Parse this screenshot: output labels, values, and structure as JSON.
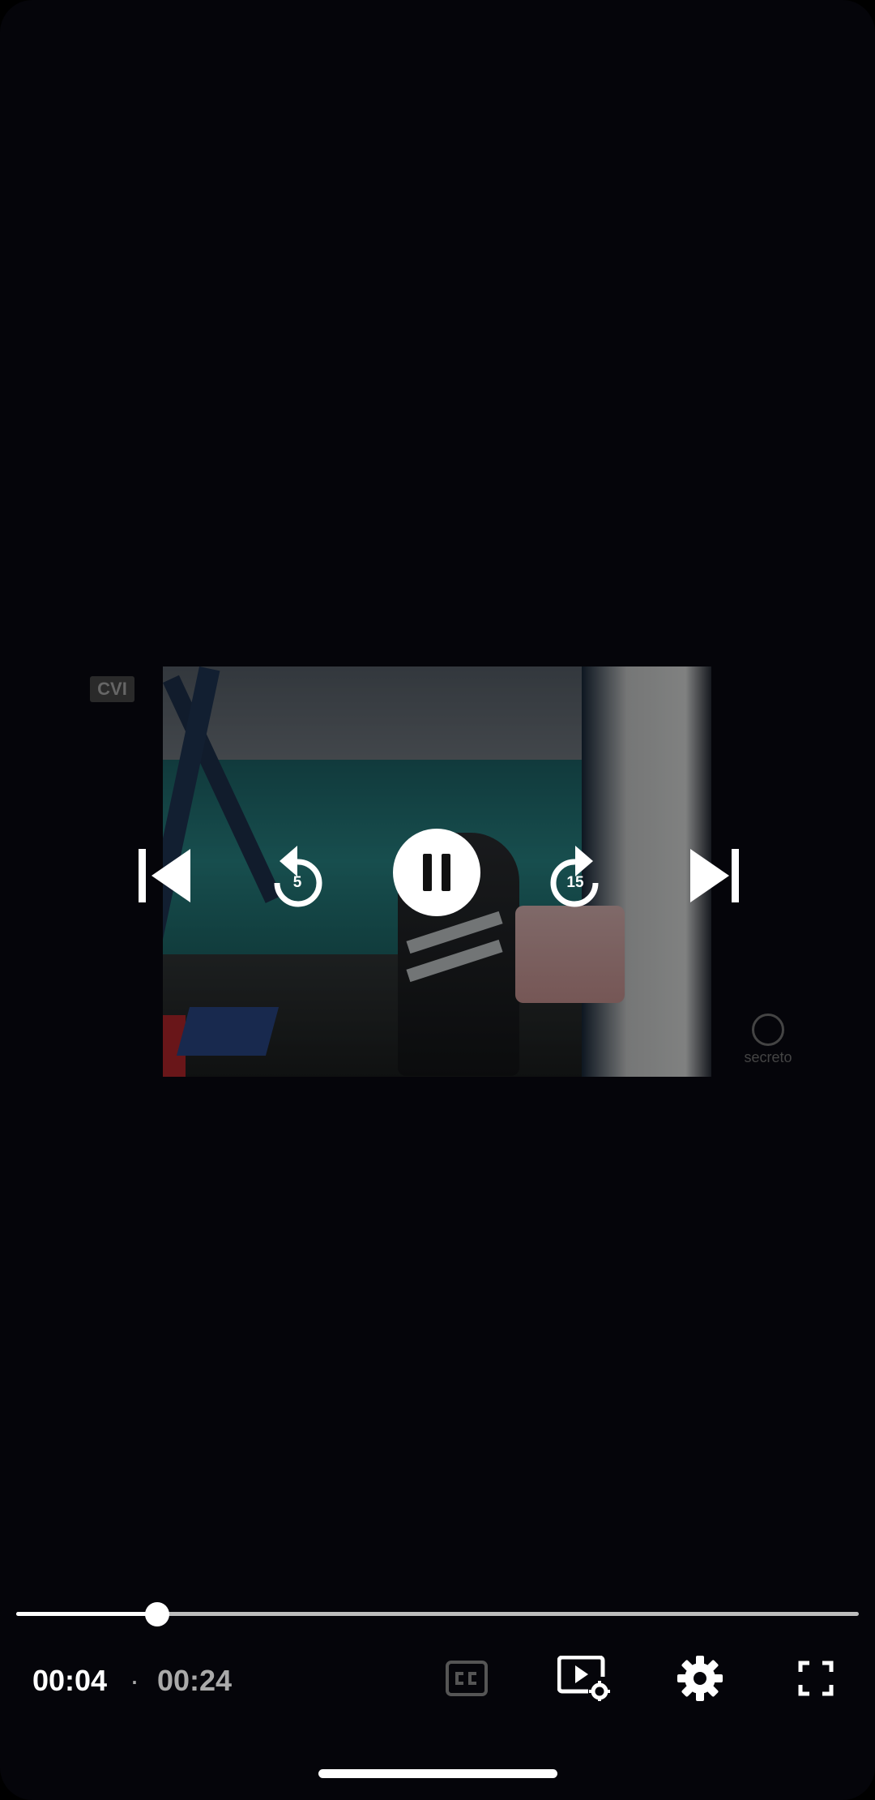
{
  "player": {
    "watermark_left": "CVI",
    "watermark_right": "secreto",
    "rewind_seconds": "5",
    "forward_seconds": "15"
  },
  "controls": {
    "time_current": "00:04",
    "time_separator": "·",
    "time_total": "00:24",
    "progress_fraction": 0.167
  },
  "icons": {
    "skip_previous": "skip-previous-icon",
    "rewind": "replay-5-icon",
    "pause": "pause-icon",
    "forward": "forward-15-icon",
    "skip_next": "skip-next-icon",
    "captions": "closed-captions-icon",
    "playback_settings": "video-settings-icon",
    "settings": "gear-icon",
    "fullscreen": "fullscreen-icon"
  }
}
